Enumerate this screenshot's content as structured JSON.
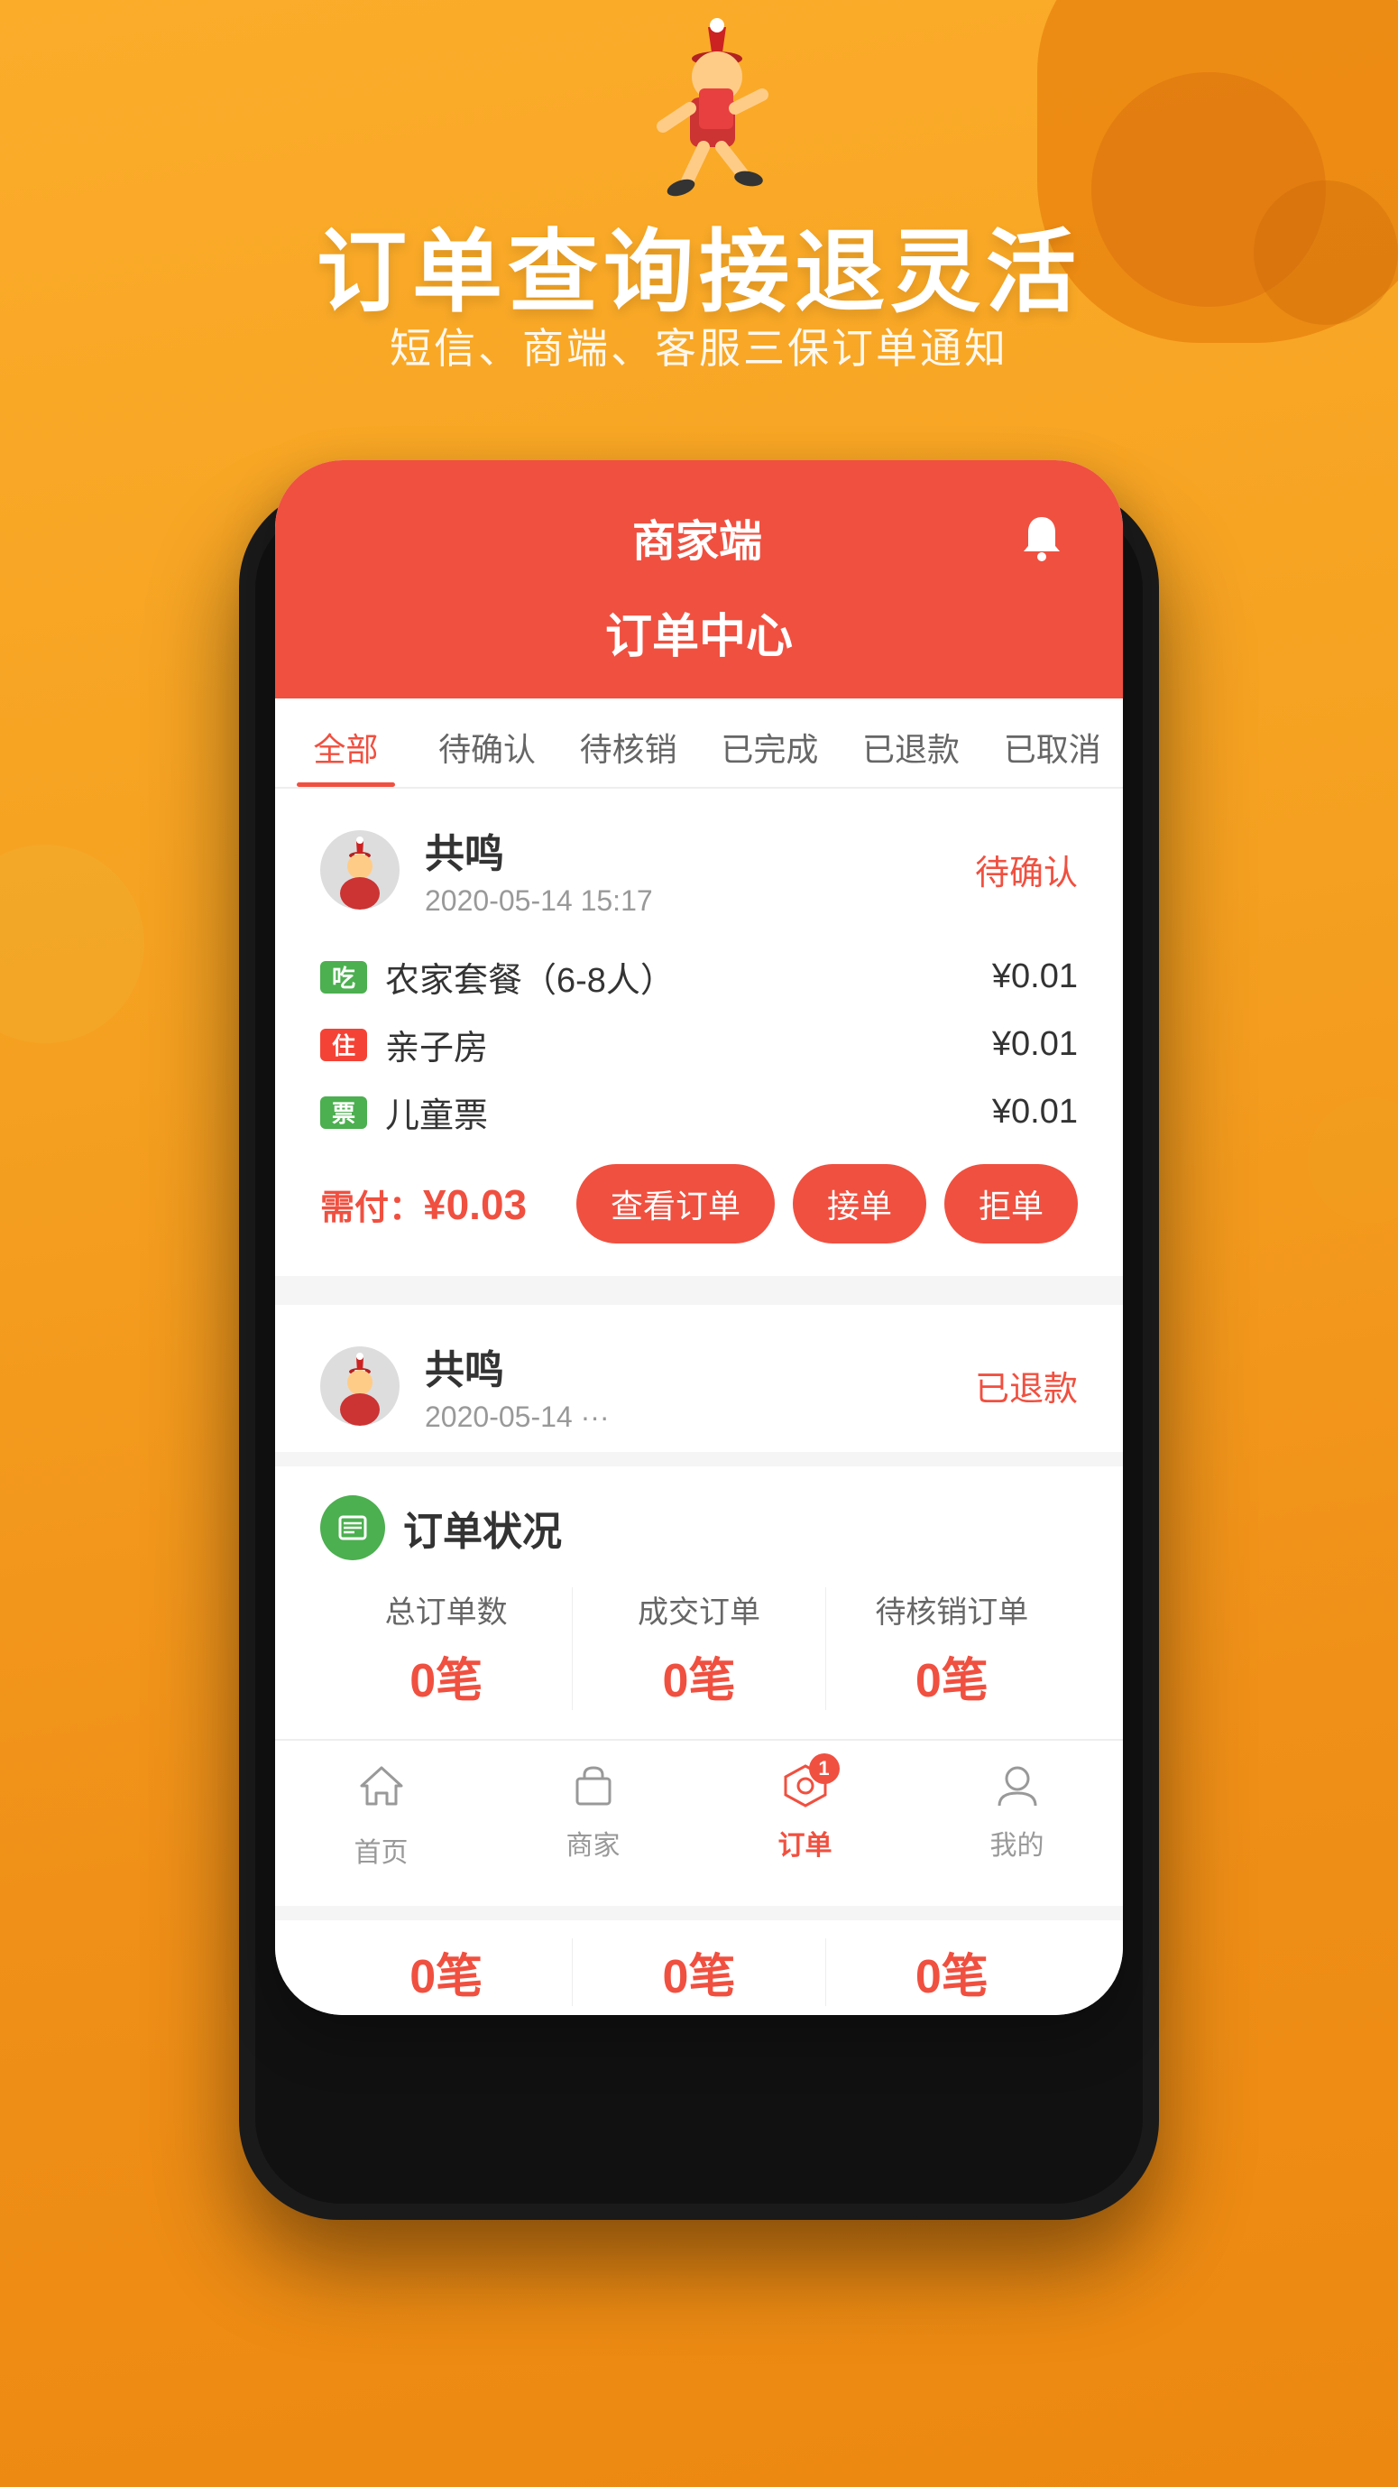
{
  "background": {
    "color": "#F5A623"
  },
  "hero": {
    "title": "订单查询接退灵活",
    "subtitle": "短信、商端、客服三保订单通知"
  },
  "app_header": {
    "merchant_label": "商家端",
    "order_center_label": "订单中心"
  },
  "tabs": [
    {
      "label": "全部",
      "active": true
    },
    {
      "label": "待确认",
      "active": false
    },
    {
      "label": "待核销",
      "active": false
    },
    {
      "label": "已完成",
      "active": false
    },
    {
      "label": "已退款",
      "active": false
    },
    {
      "label": "已取消",
      "active": false
    }
  ],
  "orders": [
    {
      "user_name": "共鸣",
      "order_time": "2020-05-14 15:17",
      "status": "待确认",
      "status_type": "pending",
      "items": [
        {
          "tag": "吃",
          "tag_type": "eat",
          "name": "农家套餐（6-8人）",
          "price": "¥0.01"
        },
        {
          "tag": "住",
          "tag_type": "stay",
          "name": "亲子房",
          "price": "¥0.01"
        },
        {
          "tag": "票",
          "tag_type": "ticket",
          "name": "儿童票",
          "price": "¥0.01"
        }
      ],
      "total_label": "需付：",
      "total_amount": "¥0.03",
      "actions": [
        {
          "label": "查看订单"
        },
        {
          "label": "接单"
        },
        {
          "label": "拒单"
        }
      ]
    },
    {
      "user_name": "共鸣",
      "status": "已退款",
      "status_type": "refunded"
    }
  ],
  "order_status_section": {
    "title": "订单状况",
    "stats": [
      {
        "label": "总订单数",
        "value": "0笔"
      },
      {
        "label": "成交订单",
        "value": "0笔"
      },
      {
        "label": "待核销订单",
        "value": "0笔"
      }
    ],
    "partial_stats": [
      {
        "label": "",
        "value": "0笔"
      },
      {
        "label": "",
        "value": "0笔"
      },
      {
        "label": "",
        "value": "0笔"
      }
    ]
  },
  "bottom_nav": {
    "items": [
      {
        "label": "首页",
        "icon": "home",
        "active": false
      },
      {
        "label": "商家",
        "icon": "shop",
        "active": false
      },
      {
        "label": "订单",
        "icon": "order",
        "active": true,
        "badge": "1"
      },
      {
        "label": "我的",
        "icon": "profile",
        "active": false
      }
    ]
  }
}
